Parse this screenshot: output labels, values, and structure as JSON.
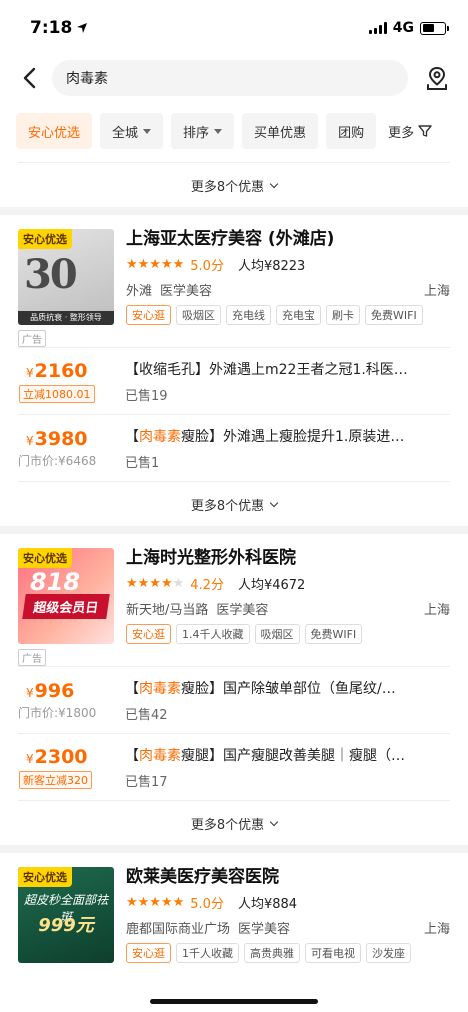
{
  "status": {
    "time": "7:18",
    "network": "4G"
  },
  "search": {
    "query": "肉毒素"
  },
  "filters": {
    "chips": [
      "安心优选",
      "全城",
      "排序",
      "买单优惠",
      "团购"
    ],
    "more": "更多"
  },
  "more_deals_label": "更多8个优惠",
  "shops": [
    {
      "image_tag": "安心优选",
      "image_text": "30",
      "image_strip": "品质抗衰 · 整形领导",
      "ad_label": "广告",
      "name": "上海亚太医疗美容 (外滩店)",
      "score": "5.0分",
      "avg": "人均¥8223",
      "area": "外滩",
      "category": "医学美容",
      "city": "上海",
      "tags": [
        "安心逛",
        "吸烟区",
        "充电线",
        "充电宝",
        "刷卡",
        "免费WIFI"
      ],
      "deals": [
        {
          "price": "2160",
          "badge": "立减1080.01",
          "orig": "",
          "kw": "",
          "title": "【收缩毛孔】外滩遇上m22王者之冠1.科医…",
          "sold": "已售19"
        },
        {
          "price": "3980",
          "badge": "",
          "orig": "门市价:¥6468",
          "kw": "肉毒素",
          "title_pre": "【",
          "title_post": "瘦脸】外滩遇上瘦脸提升1.原装进…",
          "sold": "已售1"
        }
      ]
    },
    {
      "image_tag": "安心优选",
      "image_text": "818",
      "image_strip": "超级会员日",
      "ad_label": "广告",
      "name": "上海时光整形外科医院",
      "score": "4.2分",
      "avg": "人均¥4672",
      "area": "新天地/马当路",
      "category": "医学美容",
      "city": "上海",
      "tags": [
        "安心逛",
        "1.4千人收藏",
        "吸烟区",
        "免费WIFI"
      ],
      "deals": [
        {
          "price": "996",
          "badge": "",
          "orig": "门市价:¥1800",
          "kw": "肉毒素",
          "title_pre": "【",
          "title_post": "瘦脸】国产除皱单部位（鱼尾纹/…",
          "sold": "已售42"
        },
        {
          "price": "2300",
          "badge": "新客立减320",
          "orig": "",
          "kw": "肉毒素",
          "title_pre": "【",
          "title_post": "瘦腿】国产瘦腿改善美腿｜瘦腿（…",
          "sold": "已售17"
        }
      ]
    },
    {
      "image_tag": "安心优选",
      "image_text": "超皮秒全面部祛斑",
      "image_price": "999元",
      "name": "欧莱美医疗美容医院",
      "score": "5.0分",
      "avg": "人均¥884",
      "area": "鹿都国际商业广场",
      "category": "医学美容",
      "city": "上海",
      "tags": [
        "安心逛",
        "1千人收藏",
        "高贵典雅",
        "可看电视",
        "沙发座"
      ]
    }
  ],
  "colors": {
    "accent": "#ff6a00",
    "tag_yellow": "#ffd400"
  }
}
